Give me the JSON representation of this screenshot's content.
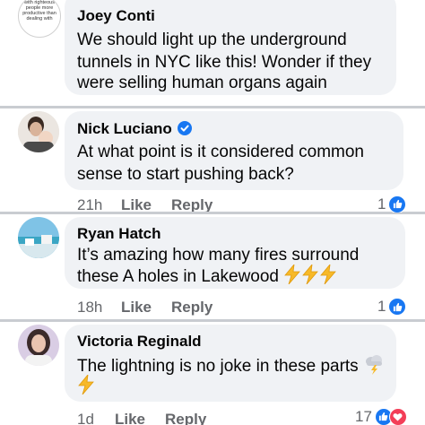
{
  "comments": [
    {
      "author": "Joey Conti",
      "avatar_text": "with righteous people more productive than dealing with",
      "lines": [
        "We should light up the underground",
        "tunnels in NYC like this! Wonder if they",
        "were selling human organs again"
      ]
    },
    {
      "author": "Nick Luciano",
      "verified": true,
      "lines": [
        "At what point is it considered common",
        "sense to start pushing back?"
      ],
      "time": "21h",
      "like_label": "Like",
      "reply_label": "Reply",
      "reaction_count": "1",
      "reactions": [
        "like-icon"
      ]
    },
    {
      "author": "Ryan Hatch",
      "lines": [
        "It’s amazing how many fires surround",
        "these A holes in Lakewood"
      ],
      "emoji": [
        "lightning-emoji",
        "lightning-emoji",
        "lightning-emoji"
      ],
      "time": "18h",
      "like_label": "Like",
      "reply_label": "Reply",
      "reaction_count": "1",
      "reactions": [
        "like-icon"
      ]
    },
    {
      "author": "Victoria Reginald",
      "lines": [
        "The lightning is no joke in these parts"
      ],
      "emoji": [
        "storm-cloud-emoji",
        "lightning-emoji"
      ],
      "time": "1d",
      "like_label": "Like",
      "reply_label": "Reply",
      "reaction_count": "17",
      "reactions": [
        "like-icon",
        "heart-icon"
      ]
    }
  ],
  "colors": {
    "bubble": "#f0f2f5",
    "separator": "#c9ccd1",
    "meta_text": "#65676b",
    "like_blue": "#1877f2",
    "heart_red": "#f33e58",
    "lightning": "#f7b928"
  }
}
